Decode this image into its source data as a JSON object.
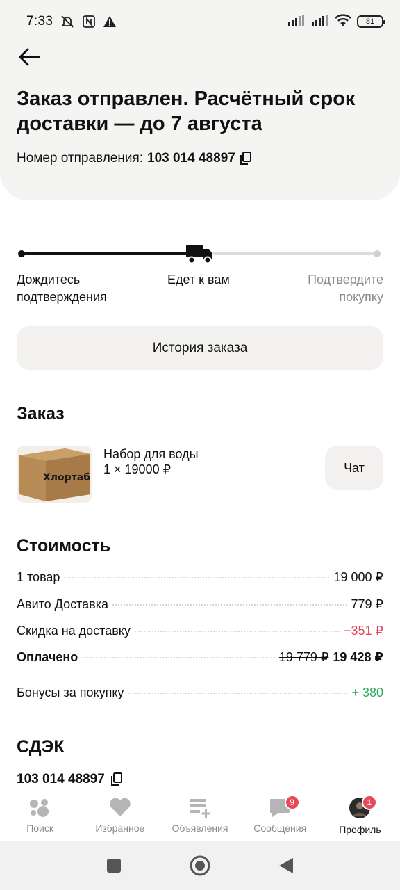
{
  "status_bar": {
    "time": "7:33",
    "battery": "81"
  },
  "header": {
    "title": "Заказ отправлен. Расчётный срок доставки — до 7 августа",
    "tracking_label": "Номер отправления:",
    "tracking_number": "103 014 48897"
  },
  "progress": {
    "steps": [
      "Дождитесь подтверждения",
      "Едет к вам",
      "Подтвердите покупку"
    ],
    "current_step": 2
  },
  "history_button": "История заказа",
  "order": {
    "title": "Заказ",
    "product_name": "Набор для воды",
    "product_qty": "1 × 19000 ₽",
    "image_text": "Хлортаб",
    "chat_button": "Чат"
  },
  "cost": {
    "title": "Стоимость",
    "rows": [
      {
        "label": "1 товар",
        "value": "19 000 ₽"
      },
      {
        "label": "Авито Доставка",
        "value": "779 ₽"
      },
      {
        "label": "Скидка на доставку",
        "value": "−351 ₽"
      },
      {
        "label": "Оплачено",
        "old_value": "19 779 ₽",
        "value": "19 428 ₽"
      },
      {
        "label": "Бонусы за покупку",
        "value": "+ 380"
      }
    ]
  },
  "carrier": {
    "title": "СДЭК",
    "tracking_number": "103 014 48897"
  },
  "bottom_nav": {
    "items": [
      {
        "label": "Поиск",
        "icon": "search-dots-icon"
      },
      {
        "label": "Избранное",
        "icon": "heart-icon"
      },
      {
        "label": "Объявления",
        "icon": "add-listing-icon"
      },
      {
        "label": "Сообщения",
        "icon": "chat-bubble-icon",
        "badge": "9"
      },
      {
        "label": "Профиль",
        "icon": "avatar-icon",
        "badge": "1"
      }
    ]
  },
  "colors": {
    "accent_red": "#e3485b",
    "bonus_green": "#2ea85a",
    "header_bg": "#f4f4f2"
  }
}
